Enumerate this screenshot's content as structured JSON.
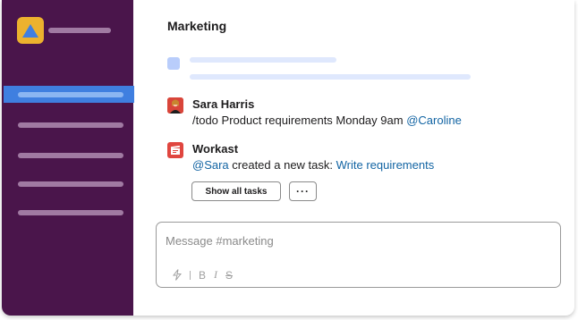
{
  "channel": {
    "title": "Marketing"
  },
  "messages": [
    {
      "author": "Sara Harris",
      "command": "/todo Product requirements Monday 9am",
      "mention": "@Caroline"
    },
    {
      "author": "Workast",
      "mention": "@Sara",
      "text": " created a new task: ",
      "link": "Write requirements"
    }
  ],
  "actions": {
    "show_all": "Show all tasks",
    "more": "···"
  },
  "composer": {
    "placeholder": "Message #marketing"
  },
  "formatting": {
    "bold": "B",
    "italic": "I",
    "strike": "S"
  },
  "colors": {
    "sidebar": "#4a154b",
    "active": "#3f7fe0",
    "link": "#1264a3",
    "logo": "#ecb22e",
    "app_avatar": "#e0463f"
  },
  "icons": {
    "workspace": "workspace-logo-icon",
    "lightning": "lightning-icon",
    "app": "workast-app-icon"
  }
}
